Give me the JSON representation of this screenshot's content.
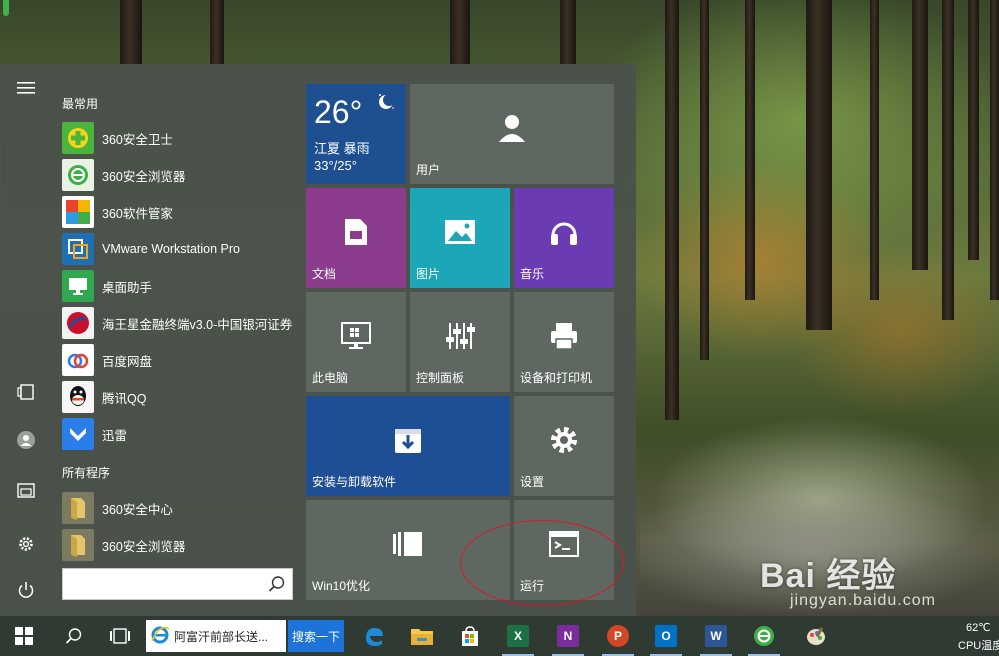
{
  "start_menu": {
    "most_used_header": "最常用",
    "all_programs_header": "所有程序",
    "most_used": [
      {
        "label": "360安全卫士",
        "icon": "360-safe-guard-icon",
        "color": "#4bb43c"
      },
      {
        "label": "360安全浏览器",
        "icon": "360-browser-icon",
        "color": "#3fae49"
      },
      {
        "label": "360软件管家",
        "icon": "360-software-manager-icon",
        "color": "#e8412c"
      },
      {
        "label": "VMware Workstation Pro",
        "icon": "vmware-icon",
        "color": "#1f6fb5"
      },
      {
        "label": "桌面助手",
        "icon": "desktop-assistant-icon",
        "color": "#2fa84f"
      },
      {
        "label": "海王星金融终端v3.0-中国银河证券",
        "icon": "neptune-finance-icon",
        "color": "#c8102e"
      },
      {
        "label": "百度网盘",
        "icon": "baidu-netdisk-icon",
        "color": "#ffffff"
      },
      {
        "label": "腾讯QQ",
        "icon": "qq-icon",
        "color": "#111111"
      },
      {
        "label": "迅雷",
        "icon": "xunlei-icon",
        "color": "#2b7de9"
      }
    ],
    "all_programs": [
      {
        "label": "360安全中心",
        "icon": "folder-icon",
        "color": "#e6c46a"
      },
      {
        "label": "360安全浏览器",
        "icon": "folder-icon",
        "color": "#e6c46a"
      }
    ],
    "search": {
      "placeholder": ""
    },
    "tiles": {
      "weather": {
        "temp": "26°",
        "location": "江夏 暴雨",
        "range": "33°/25°",
        "color": "#1d4f91"
      },
      "user": {
        "label": "用户",
        "color": "#5e6860"
      },
      "documents": {
        "label": "文档",
        "color": "#8b3c8c"
      },
      "pictures": {
        "label": "图片",
        "color": "#1ca7b8"
      },
      "music": {
        "label": "音乐",
        "color": "#6b3bb3"
      },
      "this_pc": {
        "label": "此电脑",
        "color": "#5e6860"
      },
      "control_panel": {
        "label": "控制面板",
        "color": "#5e6860"
      },
      "devices_printers": {
        "label": "设备和打印机",
        "color": "#5e6860"
      },
      "install_uninstall": {
        "label": "安装与卸载软件",
        "color": "#1e4f94"
      },
      "settings": {
        "label": "设置",
        "color": "#5e6860"
      },
      "win10_optimize": {
        "label": "Win10优化",
        "color": "#5e6860"
      },
      "run": {
        "label": "运行",
        "color": "#5e6860"
      }
    }
  },
  "taskbar": {
    "ie_tab_text": "阿富汗前部长送...",
    "search_button": "搜索一下",
    "temp": "62℃",
    "cpu": "CPU温度"
  },
  "watermark": {
    "brand": "Bai  经验",
    "url": "jingyan.baidu.com"
  }
}
